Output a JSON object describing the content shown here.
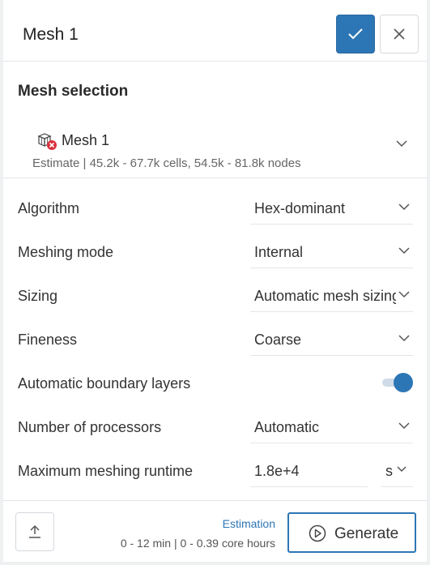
{
  "header": {
    "title": "Mesh 1",
    "confirm_icon": "check-icon",
    "close_icon": "close-icon"
  },
  "mesh_selection": {
    "section_title": "Mesh selection",
    "name": "Mesh 1",
    "estimate": "Estimate | 45.2k - 67.7k cells, 54.5k - 81.8k nodes",
    "icon": "mesh-error-icon"
  },
  "settings": {
    "algorithm": {
      "label": "Algorithm",
      "value": "Hex-dominant"
    },
    "meshing_mode": {
      "label": "Meshing mode",
      "value": "Internal"
    },
    "sizing": {
      "label": "Sizing",
      "value": "Automatic mesh sizing"
    },
    "fineness": {
      "label": "Fineness",
      "value": "Coarse"
    },
    "boundary_layers": {
      "label": "Automatic boundary layers",
      "enabled": true
    },
    "processors": {
      "label": "Number of processors",
      "value": "Automatic"
    },
    "runtime": {
      "label": "Maximum meshing runtime",
      "value": "1.8e+4",
      "unit": "s"
    }
  },
  "footer": {
    "estimation_label": "Estimation",
    "estimation_value": "0 - 12 min | 0 - 0.39 core hours",
    "generate_label": "Generate",
    "upload_icon": "upload-icon",
    "play_icon": "play-circle-icon"
  },
  "colors": {
    "accent": "#2d76b5",
    "error": "#d9303c"
  }
}
